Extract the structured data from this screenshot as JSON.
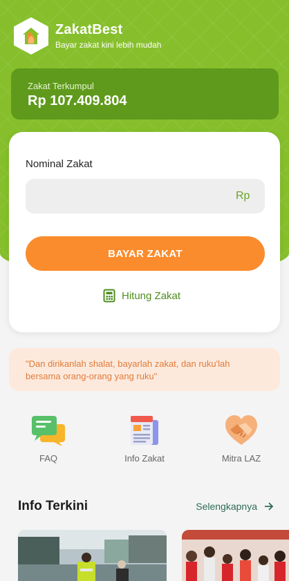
{
  "brand": {
    "name": "ZakatBest",
    "tagline": "Bayar zakat kini lebih mudah"
  },
  "collected": {
    "label": "Zakat Terkumpul",
    "amount": "Rp 107.409.804"
  },
  "form": {
    "field_label": "Nominal Zakat",
    "input_value": "",
    "placeholder": "",
    "currency": "Rp",
    "pay_label": "BAYAR ZAKAT",
    "calc_label": "Hitung Zakat"
  },
  "quote": "\"Dan dirikanlah shalat, bayarlah zakat, dan ruku'lah bersama orang-orang yang ruku\"",
  "menu": [
    {
      "label": "FAQ",
      "icon": "chat-bubbles-icon"
    },
    {
      "label": "Info Zakat",
      "icon": "newspaper-icon"
    },
    {
      "label": "Mitra LAZ",
      "icon": "handshake-icon"
    }
  ],
  "news": {
    "title": "Info Terkini",
    "more": "Selengkapnya"
  },
  "colors": {
    "primary_green": "#86bf2b",
    "dark_green": "#5f9a1c",
    "accent_orange": "#fb8c2d",
    "quote_bg": "#fde9dc",
    "link_green": "#2d6b58"
  }
}
